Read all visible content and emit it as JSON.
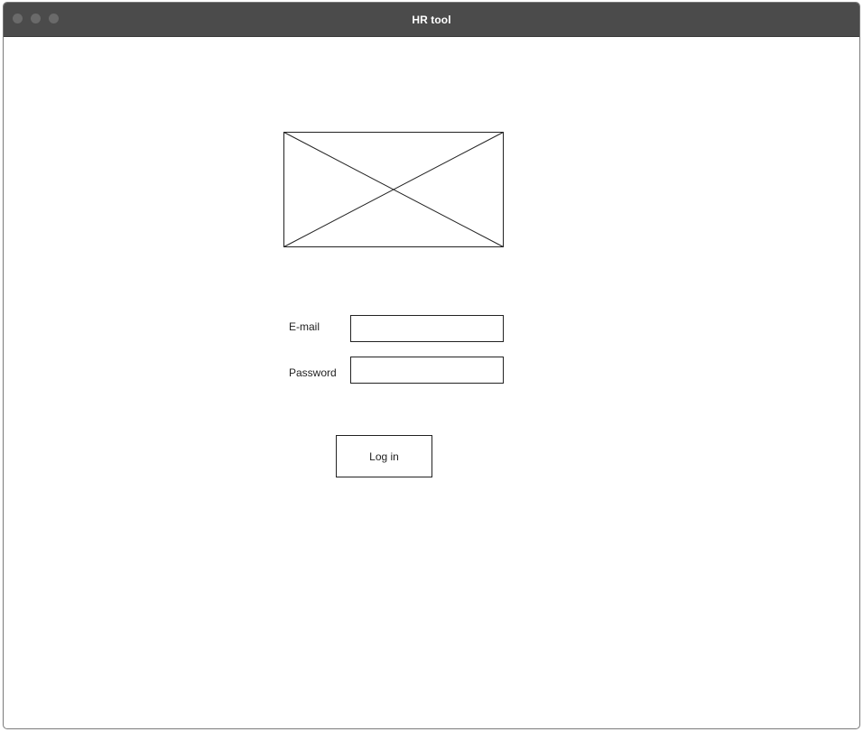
{
  "window": {
    "title": "HR tool",
    "control_dots": [
      "window-dot",
      "window-dot",
      "window-dot"
    ]
  },
  "login_form": {
    "logo": {
      "icon": "image-placeholder-icon"
    },
    "email": {
      "label": "E-mail",
      "value": "",
      "placeholder": ""
    },
    "password": {
      "label": "Password",
      "value": "",
      "placeholder": ""
    },
    "submit_label": "Log in"
  },
  "colors": {
    "titlebar": "#4b4b4b",
    "titlebar_text": "#ffffff",
    "border": "#222222",
    "background": "#ffffff"
  }
}
